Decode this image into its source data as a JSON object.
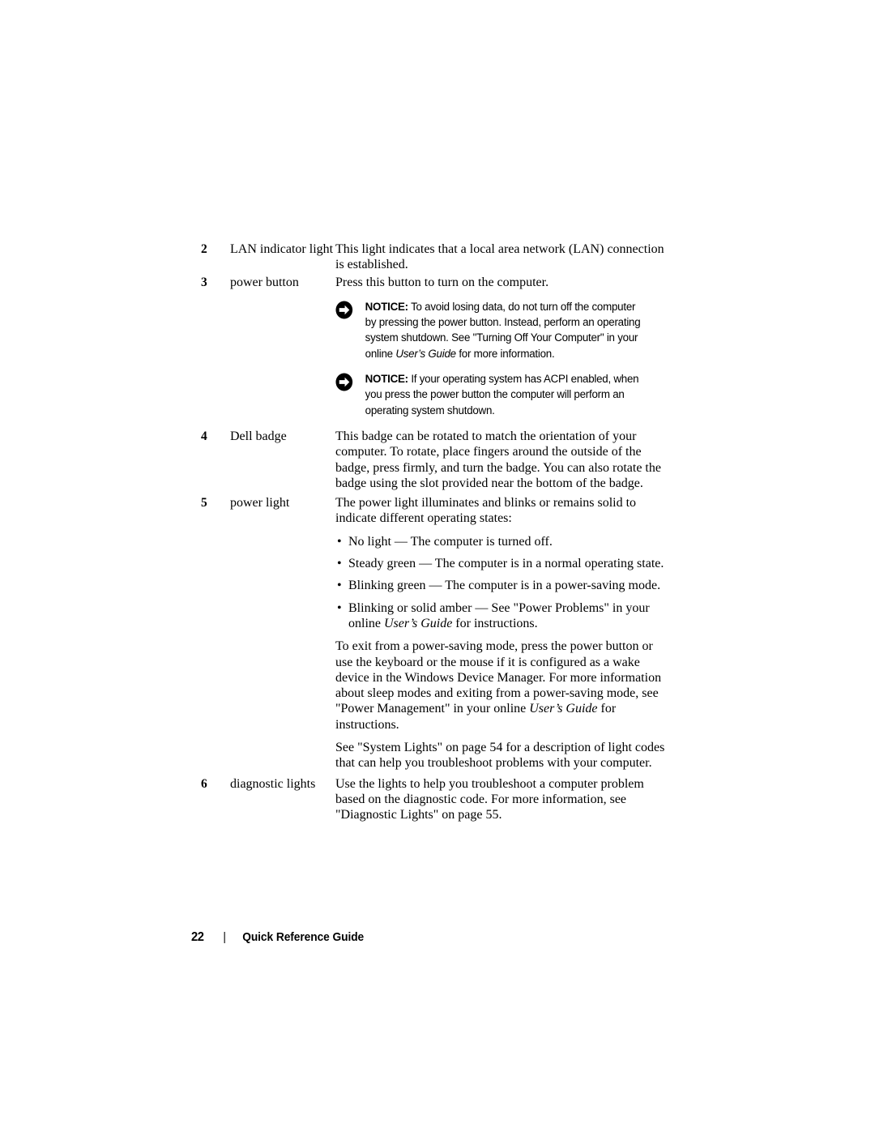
{
  "document": {
    "footer": {
      "page_number": "22",
      "separator": "|",
      "title": "Quick Reference Guide"
    }
  },
  "callouts": [
    {
      "number": "2",
      "label": "LAN indicator light",
      "description": "This light indicates that a local area network (LAN) connection is established."
    },
    {
      "number": "3",
      "label": "power button",
      "description": "Press this button to turn on the computer.",
      "notices": [
        {
          "icon": "notice-arrow-icon",
          "word": "NOTICE:",
          "text_before_italic": " To avoid losing data, do not turn off the computer by pressing the power button. Instead, perform an operating system shutdown. See \"Turning Off Your Computer\" in your online ",
          "italic": "User’s Guide",
          "text_after_italic": " for more information."
        },
        {
          "icon": "notice-arrow-icon",
          "word": "NOTICE:",
          "text_before_italic": " If your operating system has ACPI enabled, when you press the power button the computer will perform an operating system shutdown.",
          "italic": "",
          "text_after_italic": ""
        }
      ]
    },
    {
      "number": "4",
      "label": "Dell badge",
      "description": "This badge can be rotated to match the orientation of your computer. To rotate, place fingers around the outside of the badge, press firmly, and turn the badge. You can also rotate the badge using the slot provided near the bottom of the badge."
    },
    {
      "number": "5",
      "label": "power light",
      "description": "The power light illuminates and blinks or remains solid to indicate different operating states:",
      "bullets": [
        {
          "text_before_italic": "No light — The computer is turned off.",
          "italic": "",
          "text_after_italic": ""
        },
        {
          "text_before_italic": "Steady green — The computer is in a normal operating state.",
          "italic": "",
          "text_after_italic": ""
        },
        {
          "text_before_italic": "Blinking green — The computer is in a power-saving mode.",
          "italic": "",
          "text_after_italic": ""
        },
        {
          "text_before_italic": "Blinking or solid amber — See \"Power Problems\" in your online ",
          "italic": "User’s Guide",
          "text_after_italic": " for instructions."
        }
      ],
      "paragraphs": [
        {
          "text_before_italic": "To exit from a power-saving mode, press the power button or use the keyboard or the mouse if it is configured as a wake device in the Windows Device Manager. For more information about sleep modes and exiting from a power-saving mode, see \"Power Management\" in your online ",
          "italic": "User’s Guide",
          "text_after_italic": " for instructions."
        },
        {
          "text_before_italic": "See \"System Lights\" on page 54 for a description of light codes that can help you troubleshoot problems with your computer.",
          "italic": "",
          "text_after_italic": ""
        }
      ]
    },
    {
      "number": "6",
      "label": "diagnostic lights",
      "description": "Use the lights to help you troubleshoot a computer problem based on the diagnostic code. For more information, see \"Diagnostic Lights\" on page 55."
    }
  ]
}
